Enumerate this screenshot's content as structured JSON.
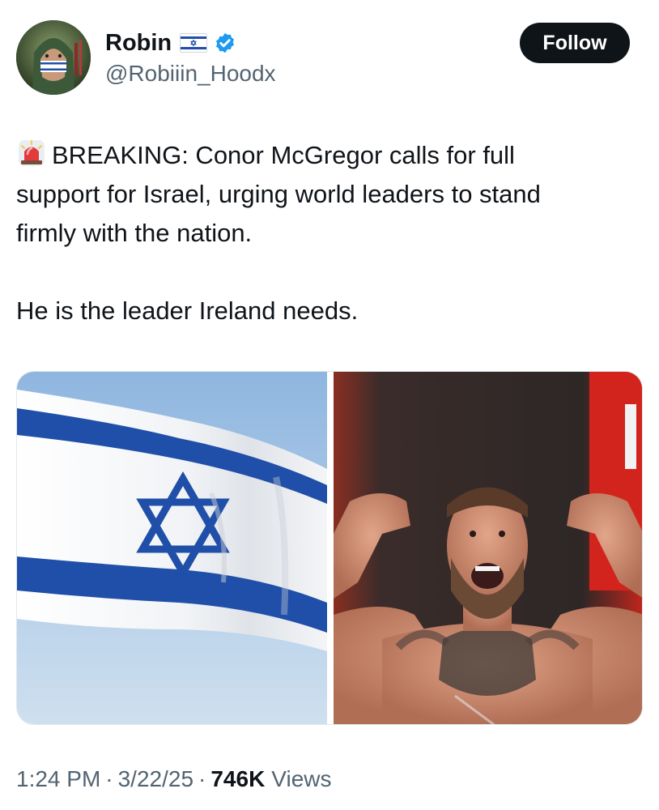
{
  "author": {
    "display_name": "Robin",
    "handle": "@Robiiin_Hoodx",
    "flag_icon": "israel-flag-emoji",
    "verified_icon": "verified-badge-icon",
    "verified_color": "#1d9bf0"
  },
  "follow_button": {
    "label": "Follow"
  },
  "tweet": {
    "emoji_icon": "police-siren-icon",
    "line1": "BREAKING: Conor McGregor calls for full",
    "line2": "support for Israel, urging world leaders to stand",
    "line3": "firmly with the nation.",
    "line4": "He is the leader Ireland needs."
  },
  "media": {
    "images": [
      {
        "subject": "israel-flag-image"
      },
      {
        "subject": "fighter-flexing-image"
      }
    ]
  },
  "meta": {
    "time": "1:24 PM",
    "separator": "·",
    "date": "3/22/25",
    "views_count": "746K",
    "views_label": "Views"
  },
  "colors": {
    "text": "#0f1419",
    "secondary": "#536471",
    "flag_blue": "#1f4fa8",
    "sky": "#a9c6e5"
  }
}
